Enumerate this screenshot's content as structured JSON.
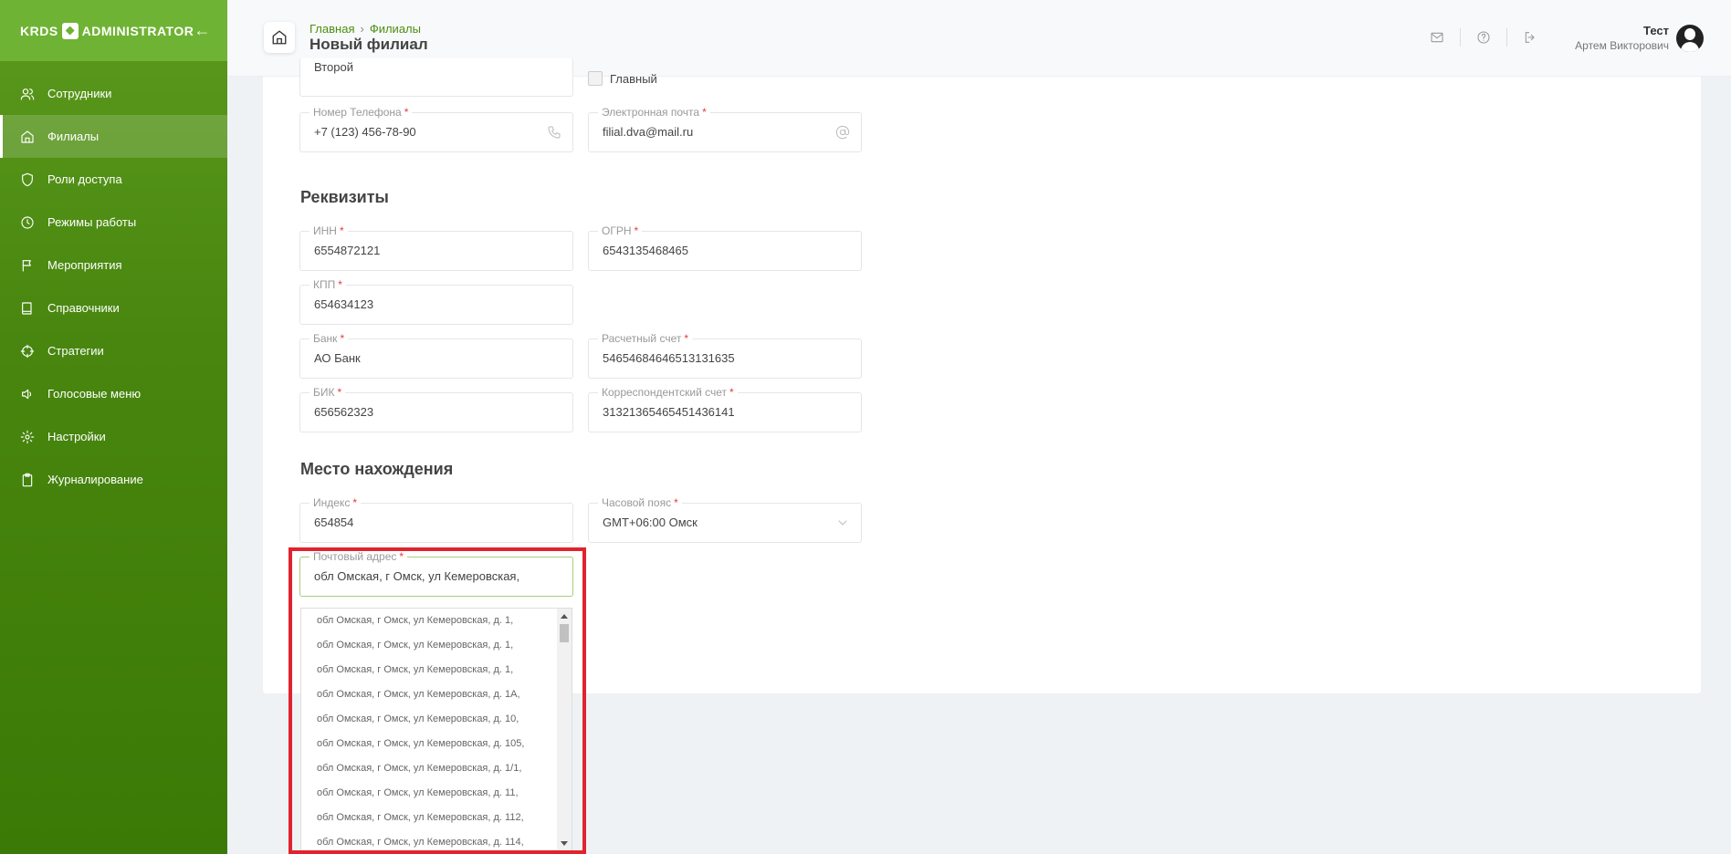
{
  "app": {
    "logo_left": "KRDS",
    "logo_right": "ADMINISTRATOR"
  },
  "sidebar": {
    "items": [
      {
        "label": "Сотрудники",
        "icon": "users-icon"
      },
      {
        "label": "Филиалы",
        "icon": "home-icon",
        "active": true
      },
      {
        "label": "Роли доступа",
        "icon": "shield-icon"
      },
      {
        "label": "Режимы работы",
        "icon": "clock-icon"
      },
      {
        "label": "Мероприятия",
        "icon": "flag-icon"
      },
      {
        "label": "Справочники",
        "icon": "book-icon"
      },
      {
        "label": "Стратегии",
        "icon": "crosshair-icon"
      },
      {
        "label": "Голосовые меню",
        "icon": "speaker-icon"
      },
      {
        "label": "Настройки",
        "icon": "gear-icon"
      },
      {
        "label": "Журналирование",
        "icon": "clipboard-icon"
      }
    ]
  },
  "header": {
    "breadcrumb": [
      "Главная",
      "Филиалы"
    ],
    "title": "Новый филиал",
    "user": {
      "name": "Тест",
      "fullname": "Артем Викторович"
    }
  },
  "form": {
    "partial_top_value": "Второй",
    "main_checkbox_label": "Главный",
    "phone": {
      "label": "Номер Телефона",
      "value": "+7 (123) 456-78-90"
    },
    "email": {
      "label": "Электронная почта",
      "value": "filial.dva@mail.ru"
    },
    "requisites_title": "Реквизиты",
    "inn": {
      "label": "ИНН",
      "value": "6554872121"
    },
    "ogrn": {
      "label": "ОГРН",
      "value": "6543135468465"
    },
    "kpp": {
      "label": "КПП",
      "value": "654634123"
    },
    "bank": {
      "label": "Банк",
      "value": "АО Банк"
    },
    "account": {
      "label": "Расчетный счет",
      "value": "54654684646513131635"
    },
    "bik": {
      "label": "БИК",
      "value": "656562323"
    },
    "corr_account": {
      "label": "Корреспондентский счет",
      "value": "31321365465451436141"
    },
    "location_title": "Место нахождения",
    "index": {
      "label": "Индекс",
      "value": "654854"
    },
    "timezone": {
      "label": "Часовой пояс",
      "value": "GMT+06:00 Омск"
    },
    "postal": {
      "label": "Почтовый адрес",
      "value": "обл Омская, г Омск, ул Кемеровская,"
    },
    "required_mark": "*"
  },
  "suggestions": [
    "обл Омская, г Омск, ул Кемеровская, д. 1,",
    "обл Омская, г Омск, ул Кемеровская, д. 1,",
    "обл Омская, г Омск, ул Кемеровская, д. 1,",
    "обл Омская, г Омск, ул Кемеровская, д. 1А,",
    "обл Омская, г Омск, ул Кемеровская, д. 10,",
    "обл Омская, г Омск, ул Кемеровская, д. 105,",
    "обл Омская, г Омск, ул Кемеровская, д. 1/1,",
    "обл Омская, г Омск, ул Кемеровская, д. 11,",
    "обл Омская, г Омск, ул Кемеровская, д. 112,",
    "обл Омская, г Омск, ул Кемеровская, д. 114,"
  ]
}
